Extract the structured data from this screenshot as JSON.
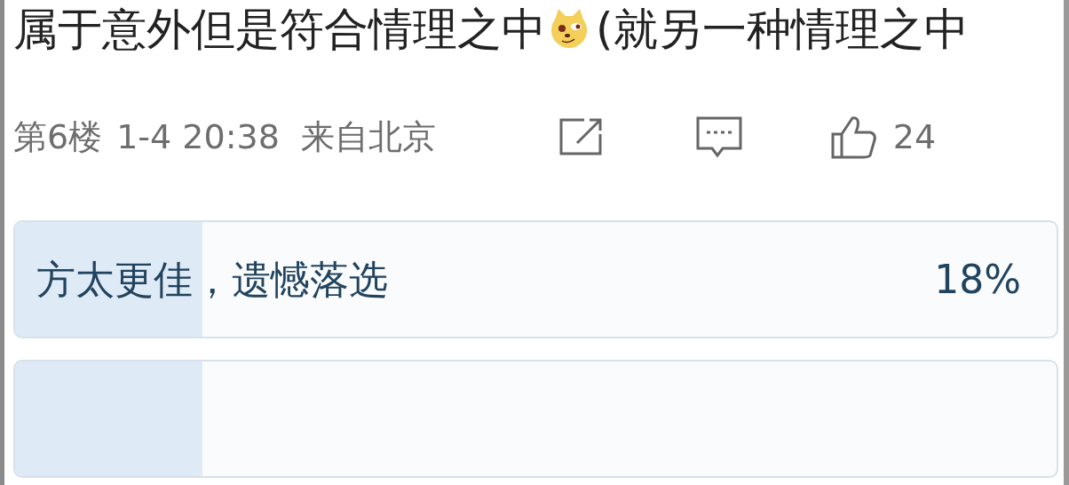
{
  "comment": {
    "text_before_emoji": "属于意外但是符合情理之中",
    "text_after_emoji": "(就另一种情理之中",
    "floor": "第6楼",
    "time": "1-4 20:38",
    "location": "来自北京",
    "likes": "24"
  },
  "poll_options": [
    {
      "label": "方太更佳，遗憾落选",
      "percent": "18%",
      "level": 0.18
    },
    {
      "level": 0.18
    }
  ]
}
